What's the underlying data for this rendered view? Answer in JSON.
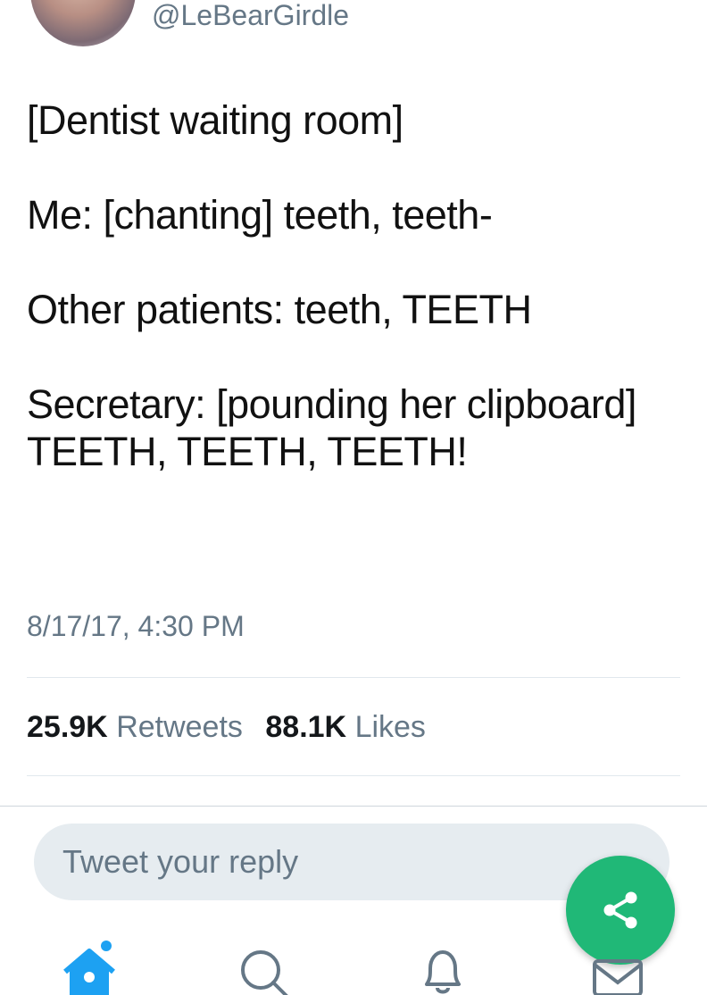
{
  "tweet": {
    "handle": "@LeBearGirdle",
    "lines": [
      "[Dentist waiting room]",
      "Me: [chanting] teeth, teeth-",
      "Other patients: teeth, TEETH",
      "Secretary: [pounding her clipboard] TEETH, TEETH, TEETH!"
    ],
    "timestamp": "8/17/17, 4:30 PM"
  },
  "stats": {
    "retweets_count": "25.9K",
    "retweets_label": "Retweets",
    "likes_count": "88.1K",
    "likes_label": "Likes"
  },
  "reply": {
    "placeholder": "Tweet your reply"
  },
  "icons": {
    "share": "share-icon",
    "home": "home-icon",
    "search": "search-icon",
    "notifications": "bell-icon",
    "messages": "mail-icon"
  },
  "colors": {
    "accent": "#1da1f2",
    "fab": "#20b877",
    "muted_text": "#657786"
  }
}
